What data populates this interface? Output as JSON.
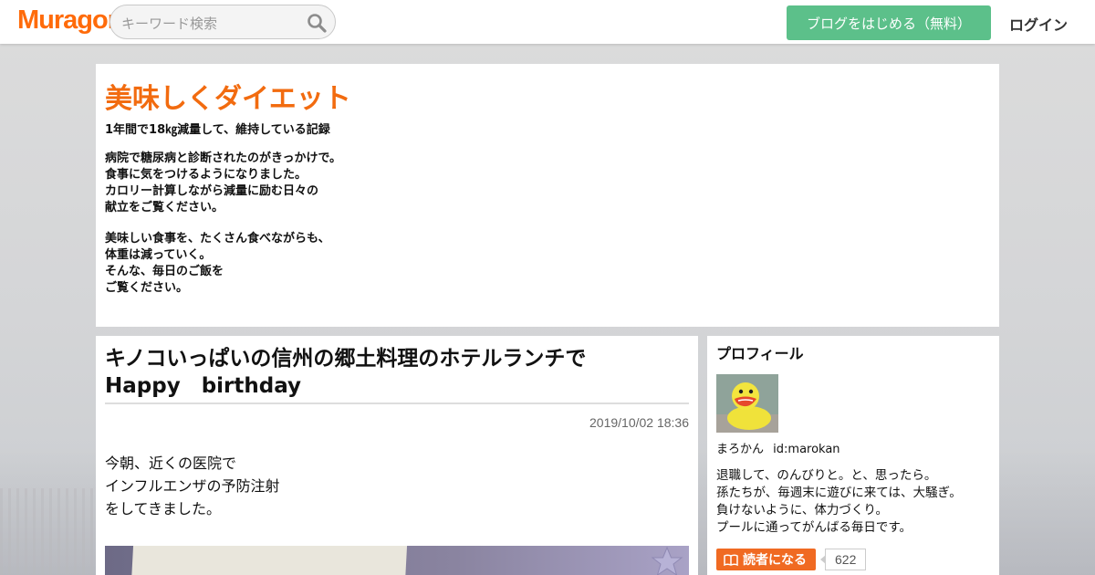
{
  "header": {
    "logo": "Muragon",
    "search_placeholder": "キーワード検索",
    "start_blog_label": "ブログをはじめる（無料）",
    "login_label": "ログイン"
  },
  "blog": {
    "title": "美味しくダイエット",
    "subtitle": "1年間で18㎏減量して、維持している記録",
    "description": [
      [
        "病院で糖尿病と診断されたのがきっかけで。",
        "食事に気をつけるようになりました。",
        "カロリー計算しながら減量に励む日々の",
        "献立をご覧ください。"
      ],
      [
        "美味しい食事を、たくさん食べながらも、",
        "体重は減っていく。",
        "そんな、毎日のご飯を",
        "ご覧ください。"
      ]
    ]
  },
  "article": {
    "title_lines": [
      "キノコいっぱいの信州の郷土料理のホテルランチで",
      "Happy　birthday"
    ],
    "date": "2019/10/02 18:36",
    "body_lines": [
      "今朝、近くの医院で",
      "インフルエンザの予防注射",
      "をしてきました。"
    ]
  },
  "sidebar": {
    "heading": "プロフィール",
    "name": "まろかん",
    "user_id": "id:marokan",
    "bio": [
      "退職して、のんびりと。と、思ったら。",
      "孫たちが、毎週末に遊びに来ては、大騒ぎ。",
      "負けないように、体力づくり。",
      "プールに通ってがんばる毎日です。"
    ],
    "follow_label": "読者になる",
    "follower_count": "622"
  },
  "colors": {
    "brand": "#ff6b0a",
    "start_button": "#5cc08a",
    "blog_title": "#f26b0f",
    "follow_button": "#f06a22"
  },
  "icons": [
    "search-icon",
    "book-icon"
  ]
}
